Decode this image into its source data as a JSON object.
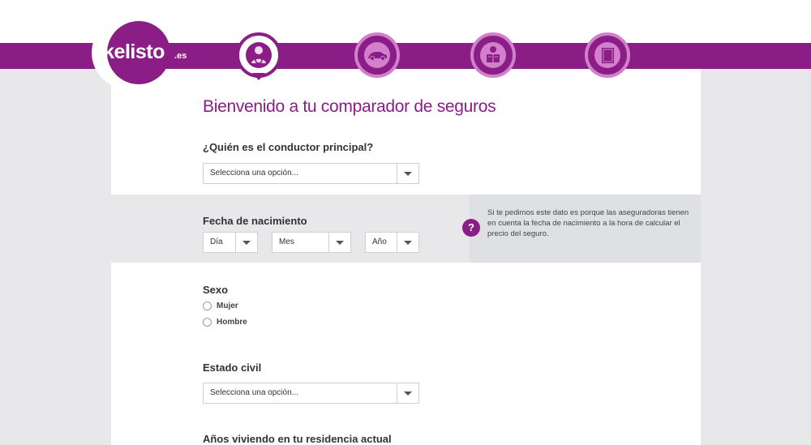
{
  "brand": {
    "logo_text": "kelisto",
    "logo_suffix": ".es",
    "color": "#8a1e86"
  },
  "steps": [
    {
      "icon": "driver-icon",
      "active": true
    },
    {
      "icon": "car-icon",
      "active": false
    },
    {
      "icon": "reading-person-icon",
      "active": false
    },
    {
      "icon": "document-icon",
      "active": false
    }
  ],
  "page": {
    "title": "Bienvenido a tu comparador de seguros"
  },
  "form": {
    "driver": {
      "label": "¿Quién es el conductor principal?",
      "value": "Selecciona una opción..."
    },
    "birthdate": {
      "label": "Fecha de nacimiento",
      "day": "Día",
      "month": "Mes",
      "year": "Año",
      "help_icon": "?",
      "help_text": "Si te pedimos este dato es porque las aseguradoras tienen en cuenta la fecha de nacimiento a la hora de calcular el precio del seguro."
    },
    "sex": {
      "label": "Sexo",
      "options": [
        "Mujer",
        "Hombre"
      ]
    },
    "marital": {
      "label": "Estado civil",
      "value": "Selecciona una opción..."
    },
    "years_residence": {
      "label": "Años viviendo en tu residencia actual"
    }
  }
}
